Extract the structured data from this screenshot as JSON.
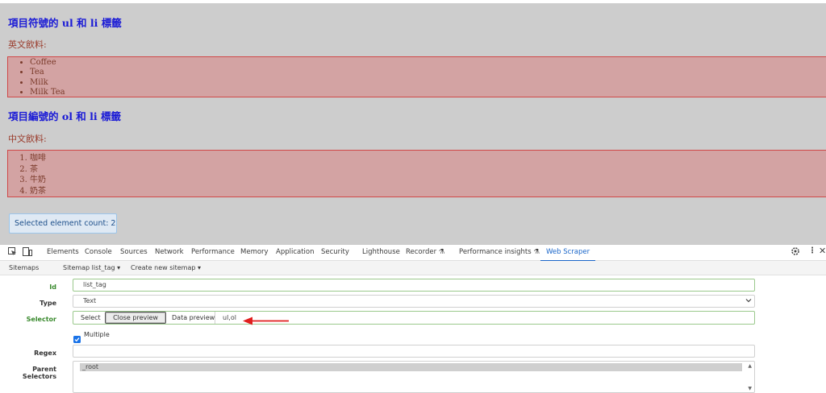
{
  "preview": {
    "ul_heading": "項目符號的 ul 和 li 標籤",
    "ul_caption": "英文飲料:",
    "ul_items": [
      "Coffee",
      "Tea",
      "Milk",
      "Milk Tea"
    ],
    "ol_heading": "項目編號的 ol 和 li 標籤",
    "ol_caption": "中文飲料:",
    "ol_items": [
      "咖啡",
      "茶",
      "牛奶",
      "奶茶"
    ],
    "selected_count": "Selected element count: 2"
  },
  "devtools": {
    "tabs": [
      "Elements",
      "Console",
      "Sources",
      "Network",
      "Performance",
      "Memory",
      "Application",
      "Security",
      "Lighthouse",
      "Recorder ⚗",
      "Performance insights ⚗",
      "Web Scraper"
    ],
    "active_tab": "Web Scraper",
    "accent_color": "#1a66c9"
  },
  "scraper": {
    "nav": [
      "Sitemaps",
      "Sitemap list_tag ▾",
      "Create new sitemap ▾"
    ],
    "labels": {
      "id": "Id",
      "type": "Type",
      "selector": "Selector",
      "regex": "Regex",
      "parent": "Parent Selectors"
    },
    "id_value": "list_tag",
    "type_value": "Text",
    "select_button": "Select",
    "close_preview_button": "Close preview",
    "data_preview_button": "Data preview",
    "selector_value": "ul,ol",
    "multiple_label": "Multiple",
    "multiple_checked": true,
    "regex_value": "",
    "parent_selector": "_root"
  }
}
